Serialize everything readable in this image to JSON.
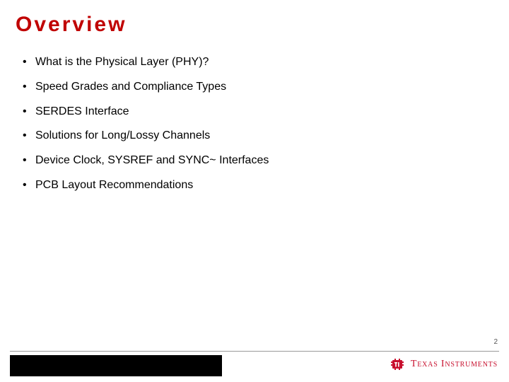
{
  "slide": {
    "title": "Overview",
    "bullets": [
      "What is the Physical Layer (PHY)?",
      "Speed Grades and Compliance Types",
      "SERDES Interface",
      "Solutions for Long/Lossy Channels",
      "Device Clock, SYSREF and SYNC~ Interfaces",
      "PCB Layout Recommendations"
    ],
    "page_number": "2"
  },
  "footer": {
    "brand": "Texas Instruments"
  },
  "colors": {
    "title": "#c00000",
    "brand": "#c8102e"
  }
}
